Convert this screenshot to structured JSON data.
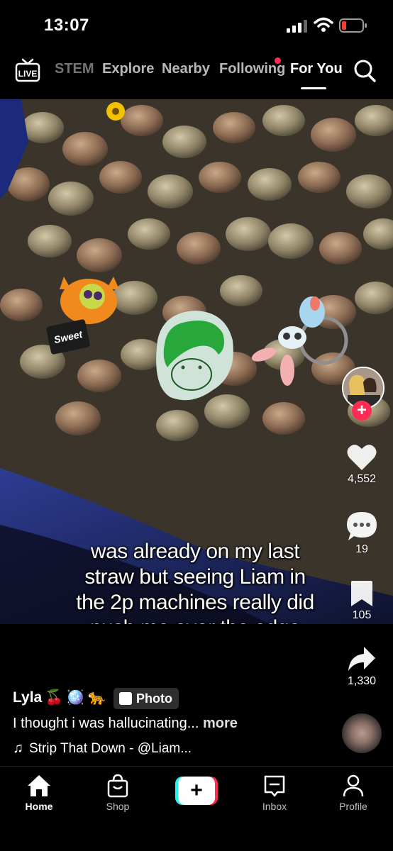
{
  "status_bar": {
    "time": "13:07"
  },
  "top_nav": {
    "tabs": [
      {
        "label": "STEM"
      },
      {
        "label": "Explore"
      },
      {
        "label": "Nearby"
      },
      {
        "label": "Following"
      },
      {
        "label": "For You"
      }
    ],
    "active_tab": "For You",
    "live_label": "LIVE"
  },
  "post": {
    "caption": "was already on my last straw but seeing Liam in the 2p machines really did push me over the edge",
    "caption_lines": [
      "was already on my last",
      "straw but seeing Liam in",
      "the 2p machines really did",
      "push me over the edge"
    ],
    "keychain_text": "Sweet",
    "likes": "4,552",
    "comments": "19",
    "saves": "105",
    "shares": "1,330",
    "author": "Lyla",
    "author_emojis": [
      "🍒",
      "🪩",
      "🐆"
    ],
    "type_badge": "Photo",
    "description": "I thought i was hallucinating...",
    "more_label": "more",
    "music": "Strip That Down - @Liam..."
  },
  "colors": {
    "accent_red": "#fe2c55",
    "accent_cyan": "#25f4ee"
  },
  "bottom_nav": {
    "items": [
      {
        "label": "Home",
        "icon": "home-icon"
      },
      {
        "label": "Shop",
        "icon": "shop-bag-icon"
      },
      {
        "label": "Inbox",
        "icon": "inbox-icon"
      },
      {
        "label": "Profile",
        "icon": "profile-icon"
      }
    ],
    "active": "Home"
  }
}
